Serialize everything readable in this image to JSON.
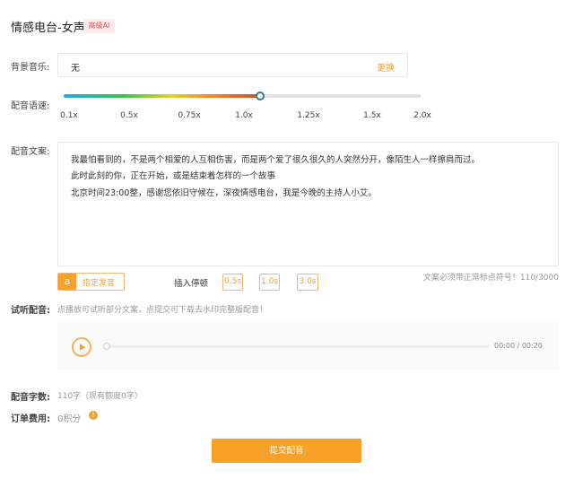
{
  "header": {
    "title": "情感电台-女声",
    "badge": "高级AI"
  },
  "background_music": {
    "label": "背景音乐:",
    "value": "无",
    "change": "更换"
  },
  "speed": {
    "label": "配音语速:",
    "ticks": [
      "0.1x",
      "0.5x",
      "0.75x",
      "1.0x",
      "1.25x",
      "1.5x",
      "2.0x"
    ],
    "value_fraction": 0.55
  },
  "script": {
    "label": "配音文案:",
    "lines": [
      "我最怕看到的，不是两个相爱的人互相伤害，而是两个爱了很久很久的人突然分开，像陌生人一样擦肩而过。",
      "此时此刻的你，正在开始，或是结束着怎样的一个故事",
      "北京时间23:00整，感谢您依旧守候在，深夜情感电台，我是今晚的主持人小艾。"
    ],
    "pronounce_icon": "a",
    "pronounce_button": "指定发音",
    "pause_label": "插入停顿",
    "pauses": [
      "0.5s",
      "1.0s",
      "3.0s"
    ],
    "hint": "文案必须带正常标点符号！110/3000"
  },
  "preview": {
    "label": "试听配音:",
    "hint": "点播放可试听部分文案，点提交可下载去水印完整版配音！",
    "time": "00:00 / 00:20",
    "progress": 0
  },
  "count": {
    "label": "配音字数:",
    "value": "110字（现有额度0字）"
  },
  "fee": {
    "label": "订单费用:",
    "value": "0积分"
  },
  "submit": "提交配音",
  "colors": {
    "accent": "#f7a02a"
  }
}
